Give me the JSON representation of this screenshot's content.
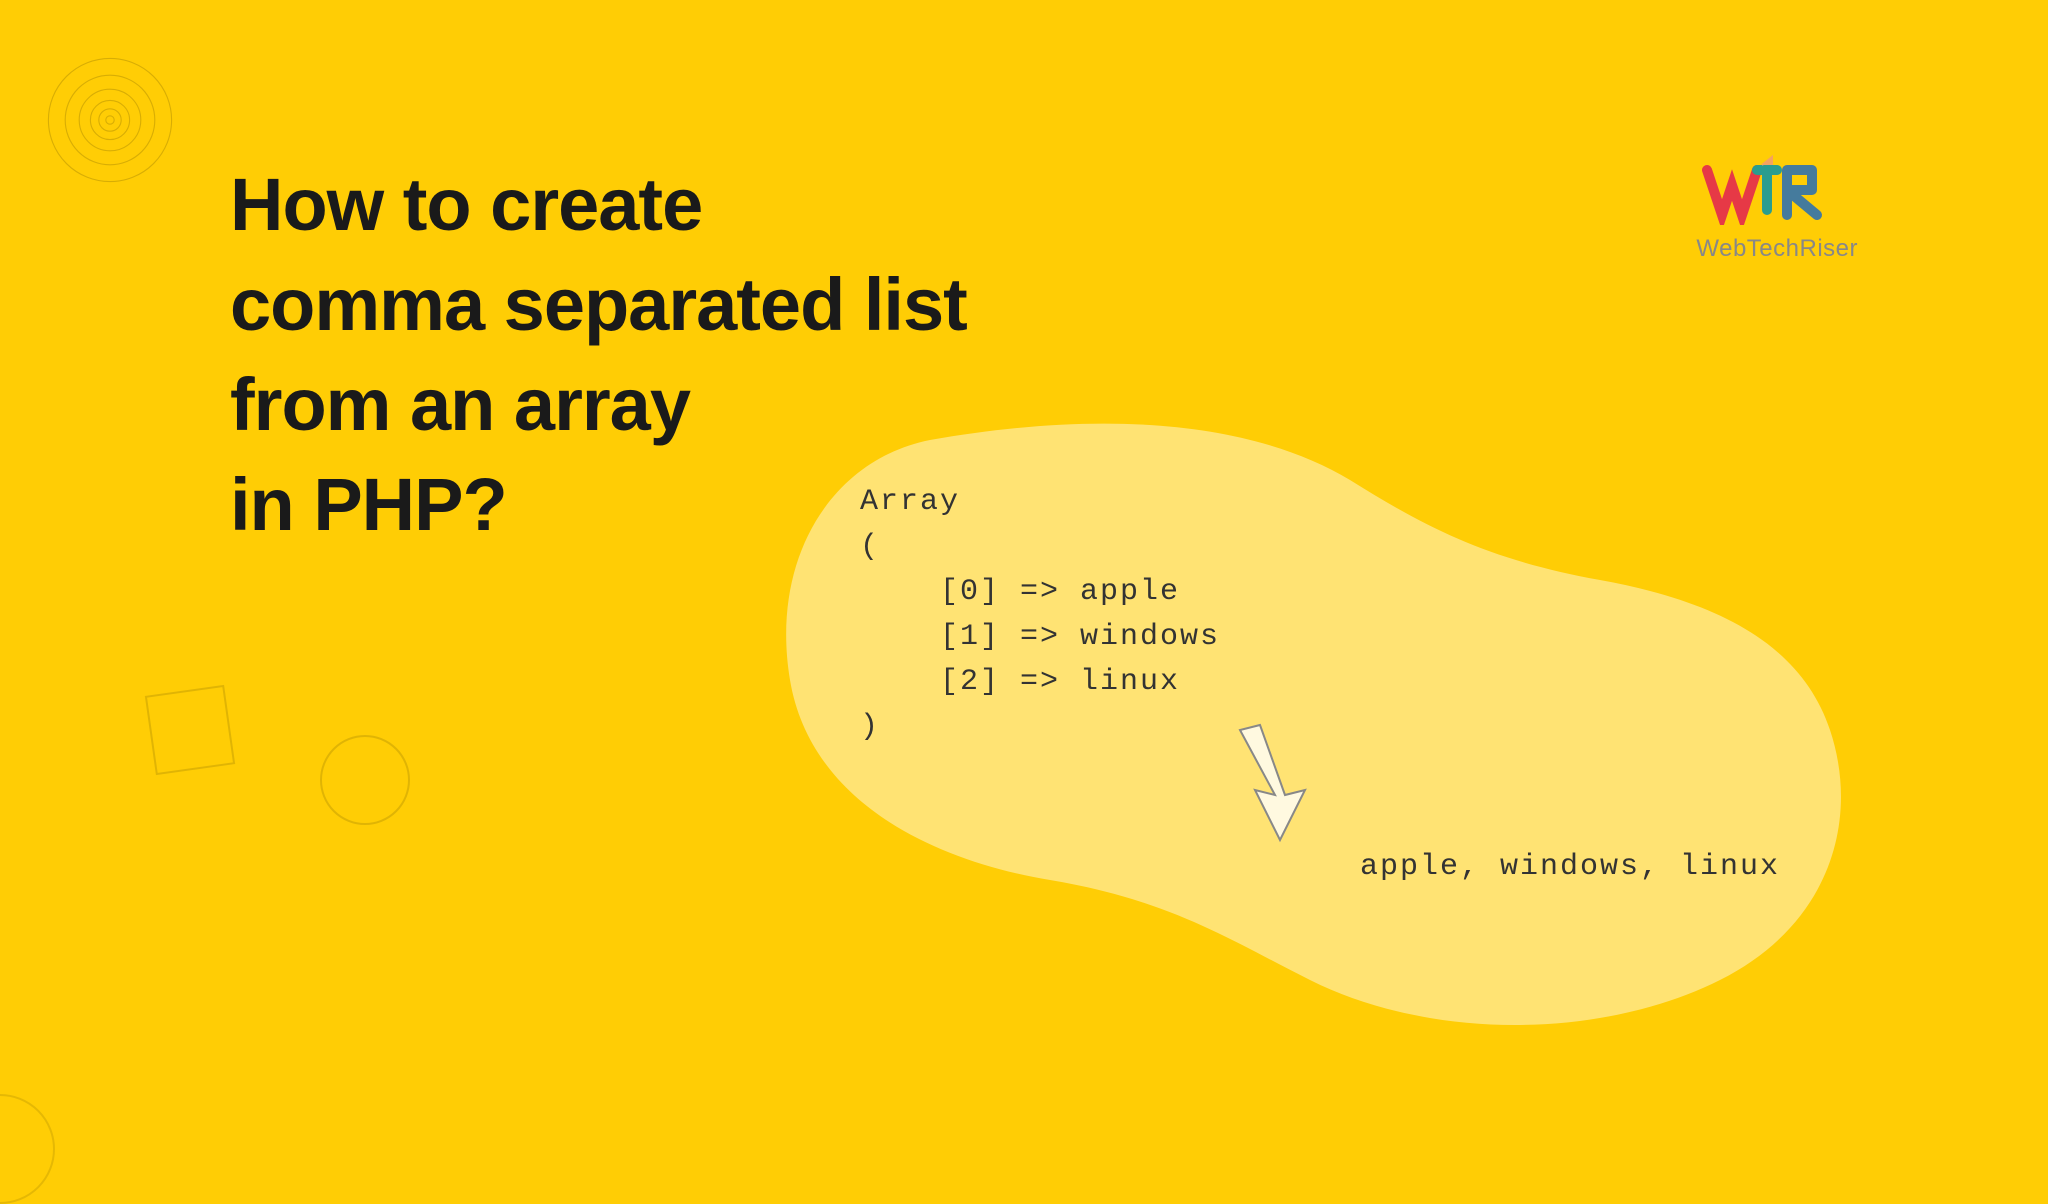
{
  "title": {
    "line1": "How to create",
    "line2": "comma separated list",
    "line3": "from an array",
    "line4": "in PHP?"
  },
  "logo": {
    "text": "WebTechRiser"
  },
  "code": {
    "array_label": "Array",
    "open_paren": "(",
    "item0": "    [0] => apple",
    "item1": "    [1] => windows",
    "item2": "    [2] => linux",
    "close_paren": ")"
  },
  "output": "apple, windows, linux"
}
